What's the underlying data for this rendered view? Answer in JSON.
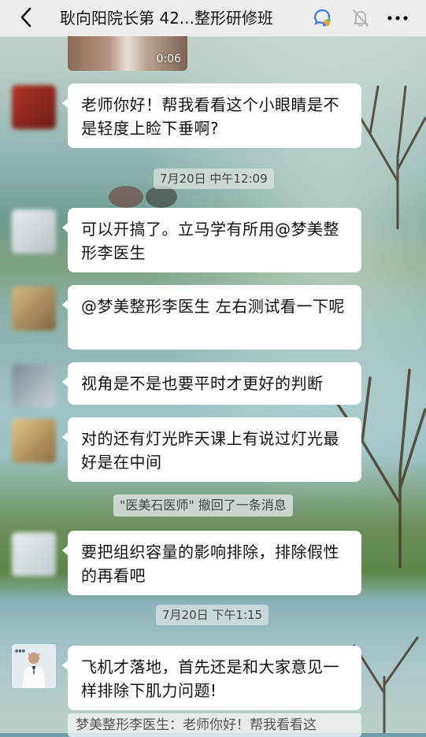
{
  "nav": {
    "title": "耿向阳院长第 42...整形研修班"
  },
  "video": {
    "duration": "0:06"
  },
  "messages": [
    {
      "text": "老师你好！帮我看看这个小眼睛是不是轻度上睑下垂啊?"
    },
    {
      "text": "可以开搞了。立马学有所用@梦美整形李医生"
    },
    {
      "text": "@梦美整形李医生  左右测试看一下呢"
    },
    {
      "text": "视角是不是也要平时才更好的判断"
    },
    {
      "text": "对的还有灯光昨天课上有说过灯光最好是在中间"
    },
    {
      "text": "要把组织容量的影响排除，排除假性的再看吧"
    },
    {
      "text": "飞机才落地，首先还是和大家意见一样排除下肌力问题!"
    }
  ],
  "timestamps": {
    "t1": "7月20日 中午12:09",
    "t2": "7月20日 下午1:15"
  },
  "system": {
    "recall": "\"医美石医师\" 撤回了一条消息"
  },
  "quote": {
    "text": "梦美整形李医生：老师你好！帮我看看这"
  },
  "colors": {
    "bubble": "#ffffff",
    "navbar": "#ededed",
    "wecom_blue": "#3e7bfa"
  },
  "icons": [
    "back-chevron-icon",
    "wecom-badge-icon",
    "mute-bell-icon",
    "more-dots-icon"
  ]
}
